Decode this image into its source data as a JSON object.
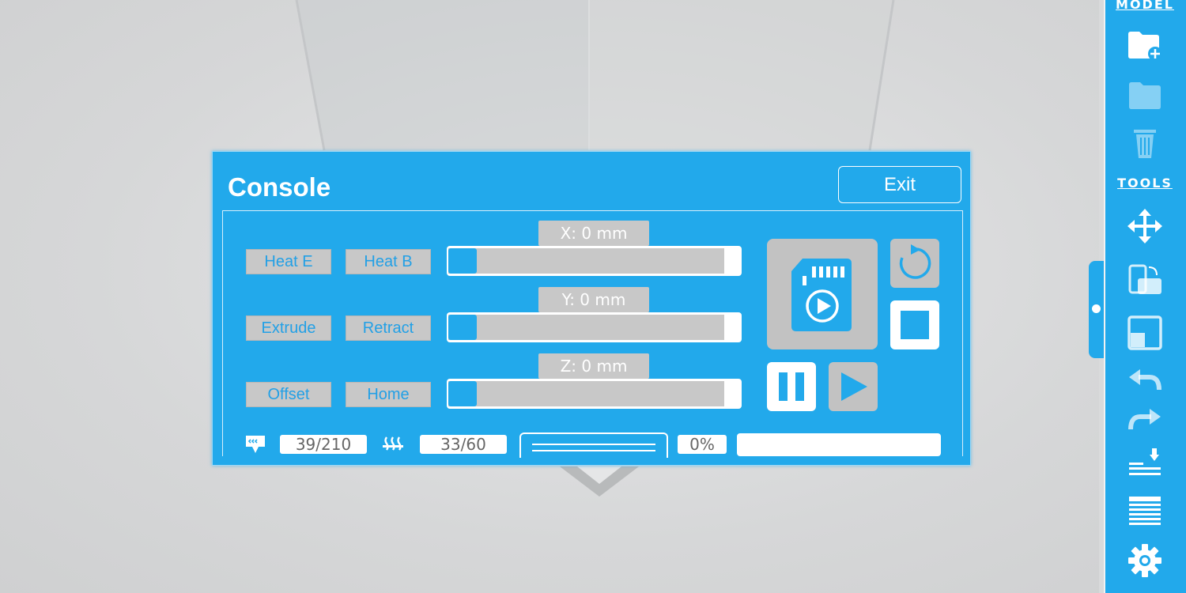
{
  "toolbar": {
    "model_label": "MODEL",
    "tools_label": "TOOLS",
    "model_buttons": [
      "add-model-icon",
      "open-folder-icon",
      "trash-icon"
    ],
    "tool_buttons": [
      "move-icon",
      "rotate-model-icon",
      "scale-icon",
      "undo-icon",
      "redo-icon",
      "slice-icon",
      "layers-icon",
      "gear-icon"
    ],
    "accent_color": "#22a9eb"
  },
  "console": {
    "title": "Console",
    "exit_label": "Exit",
    "buttons": {
      "heat_e": "Heat E",
      "heat_b": "Heat B",
      "extrude": "Extrude",
      "retract": "Retract",
      "offset": "Offset",
      "home": "Home"
    },
    "axes": {
      "x_label": "X: 0 mm",
      "y_label": "Y: 0 mm",
      "z_label": "Z: 0 mm"
    },
    "status": {
      "extruder_temp": "39/210",
      "bed_temp": "33/60",
      "progress": "0%"
    },
    "icons": [
      "sd-card-print-icon",
      "refresh-icon",
      "stop-icon",
      "pause-icon",
      "play-icon",
      "extruder-icon",
      "heated-bed-icon"
    ]
  }
}
